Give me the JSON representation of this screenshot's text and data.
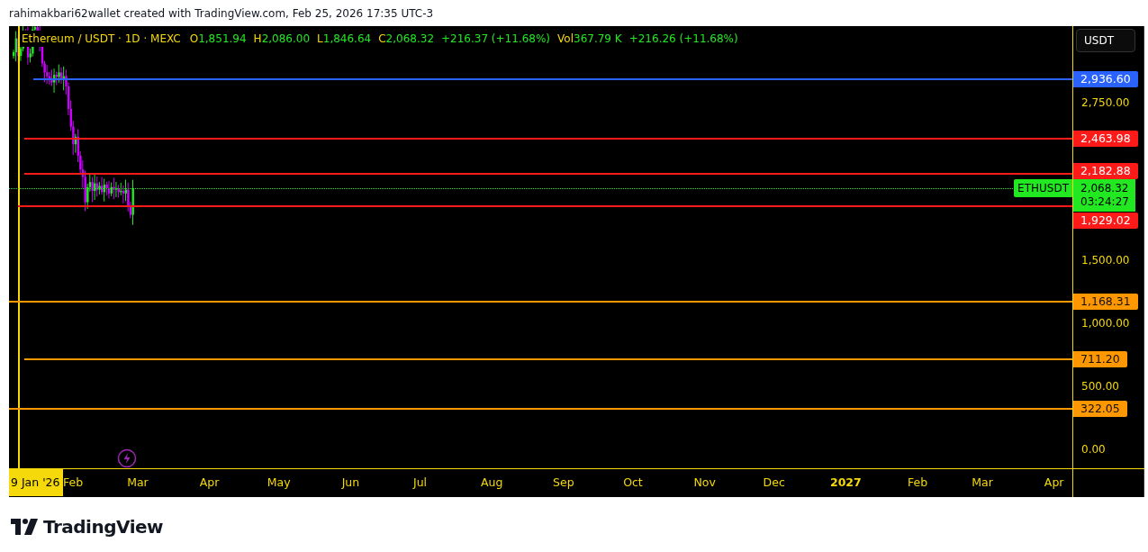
{
  "header": {
    "text": "rahimakbari62wallet created with TradingView.com, Feb 25, 2026 17:35 UTC-3"
  },
  "legend": {
    "title": "Ethereum / USDT · 1D · MEXC",
    "ohlc": [
      {
        "label": "O",
        "value": "1,851.94"
      },
      {
        "label": "H",
        "value": "2,086.00"
      },
      {
        "label": "L",
        "value": "1,846.64"
      },
      {
        "label": "C",
        "value": "2,068.32"
      }
    ],
    "change": "+216.37 (+11.68%)",
    "volume_label": "Vol",
    "volume_value": "367.79 K",
    "volume_change": "+216.26 (+11.68%)"
  },
  "currency_button": "USDT",
  "price_ticks": [
    "2,750.00",
    "1,500.00",
    "1,000.00",
    "500.00",
    "0.00"
  ],
  "levels": [
    {
      "price": "2,936.60",
      "color": "#2962ff"
    },
    {
      "price": "2,463.98",
      "color": "#ff1a1a"
    },
    {
      "price": "2,182.88",
      "color": "#ff1a1a"
    },
    {
      "price": "1,929.02",
      "color": "#ff1a1a"
    },
    {
      "price": "1,168.31",
      "color": "#ff9800"
    },
    {
      "price": "711.20",
      "color": "#ff9800"
    },
    {
      "price": "322.05",
      "color": "#ff9800"
    }
  ],
  "current_price": {
    "symbol": "ETHUSDT",
    "price": "2,068.32",
    "countdown": "03:24:27"
  },
  "time_axis": {
    "cursor_label": "9 Jan '26",
    "labels": [
      {
        "text": "Feb",
        "kind": "month"
      },
      {
        "text": "Mar",
        "kind": "month"
      },
      {
        "text": "Apr",
        "kind": "month"
      },
      {
        "text": "May",
        "kind": "month"
      },
      {
        "text": "Jun",
        "kind": "month"
      },
      {
        "text": "Jul",
        "kind": "month"
      },
      {
        "text": "Aug",
        "kind": "month"
      },
      {
        "text": "Sep",
        "kind": "month"
      },
      {
        "text": "Oct",
        "kind": "month"
      },
      {
        "text": "Nov",
        "kind": "month"
      },
      {
        "text": "Dec",
        "kind": "month"
      },
      {
        "text": "2027",
        "kind": "year"
      },
      {
        "text": "Feb",
        "kind": "month"
      },
      {
        "text": "Mar",
        "kind": "month"
      },
      {
        "text": "Apr",
        "kind": "month"
      }
    ]
  },
  "footer": {
    "brand": "TradingView"
  }
}
